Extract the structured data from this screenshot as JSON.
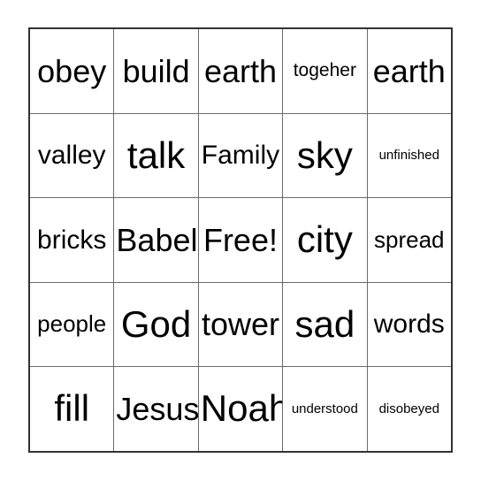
{
  "card": {
    "name": "bingo-card",
    "columns": 5,
    "rows": 5,
    "free_space": "Free!",
    "free_space_position": {
      "row": 3,
      "column": 3
    },
    "colors": {
      "background": "#ffffff",
      "text": "#000000",
      "outer_border": "#333333",
      "inner_grid_line": "#6b6b6b"
    },
    "cells": [
      [
        {
          "text": "obey",
          "size": "lg"
        },
        {
          "text": "build",
          "size": "lg"
        },
        {
          "text": "earth",
          "size": "lg"
        },
        {
          "text": "togeher",
          "size": "xs"
        },
        {
          "text": "earth",
          "size": "lg"
        }
      ],
      [
        {
          "text": "valley",
          "size": "md"
        },
        {
          "text": "talk",
          "size": "xl"
        },
        {
          "text": "Family",
          "size": "md"
        },
        {
          "text": "sky",
          "size": "xl"
        },
        {
          "text": "unfinished",
          "size": "xxs"
        }
      ],
      [
        {
          "text": "bricks",
          "size": "md"
        },
        {
          "text": "Babel",
          "size": "lg"
        },
        {
          "text": "Free!",
          "size": "lg"
        },
        {
          "text": "city",
          "size": "xl"
        },
        {
          "text": "spread",
          "size": "sm"
        }
      ],
      [
        {
          "text": "people",
          "size": "sm"
        },
        {
          "text": "God",
          "size": "xl"
        },
        {
          "text": "tower",
          "size": "lg"
        },
        {
          "text": "sad",
          "size": "xl"
        },
        {
          "text": "words",
          "size": "md"
        }
      ],
      [
        {
          "text": "fill",
          "size": "xl"
        },
        {
          "text": "Jesus",
          "size": "lg"
        },
        {
          "text": "Noah",
          "size": "xl"
        },
        {
          "text": "understood",
          "size": "xxs"
        },
        {
          "text": "disobeyed",
          "size": "xxs"
        }
      ]
    ]
  }
}
